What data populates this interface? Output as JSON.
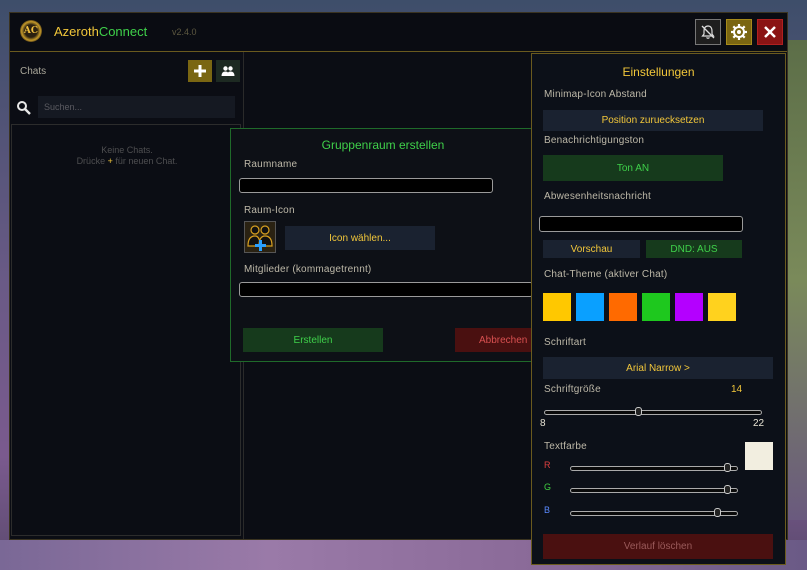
{
  "app": {
    "title_a": "Azeroth",
    "title_b": "Connect",
    "version": "v2.4.0",
    "logo_text": "AC"
  },
  "sidebar": {
    "chats_label": "Chats",
    "search_placeholder": "Suchen...",
    "empty_line1": "Keine Chats.",
    "empty_line2_pre": "Drücke",
    "empty_line2_plus": "+",
    "empty_line2_post": "für neuen Chat."
  },
  "dialog": {
    "title": "Gruppenraum erstellen",
    "room_name_label": "Raumname",
    "room_icon_label": "Raum-Icon",
    "choose_icon_btn": "Icon wählen...",
    "members_label": "Mitglieder (kommagetrennt)",
    "create_btn": "Erstellen",
    "abort_btn": "Abbrechen"
  },
  "settings": {
    "title": "Einstellungen",
    "minimap_label": "Minimap-Icon Abstand",
    "reset_pos_btn": "Position zuruecksetzen",
    "notif_sound_label": "Benachrichtigungston",
    "tone_btn": "Ton AN",
    "away_label": "Abwesenheitsnachricht",
    "preview_btn": "Vorschau",
    "dnd_btn": "DND: AUS",
    "theme_label": "Chat-Theme (aktiver Chat)",
    "theme_colors": [
      "#ffc800",
      "#0aa0ff",
      "#ff6a00",
      "#1ec81e",
      "#b400ff",
      "#ffd21e"
    ],
    "font_label": "Schriftart",
    "font_btn": "Arial Narrow  >",
    "font_size_label": "Schriftgröße",
    "font_size_value": "14",
    "font_size_min": "8",
    "font_size_max": "22",
    "font_size_fraction": 0.43,
    "text_color_label": "Textfarbe",
    "r_label": "R",
    "g_label": "G",
    "b_label": "B",
    "r_value": 0.96,
    "g_value": 0.96,
    "b_value": 0.9,
    "text_color_hex": "#f2eee0",
    "clear_history_btn": "Verlauf löschen"
  },
  "colors": {
    "gold": "#f2c73a",
    "green": "#3fd04a",
    "red": "#8a1414"
  }
}
